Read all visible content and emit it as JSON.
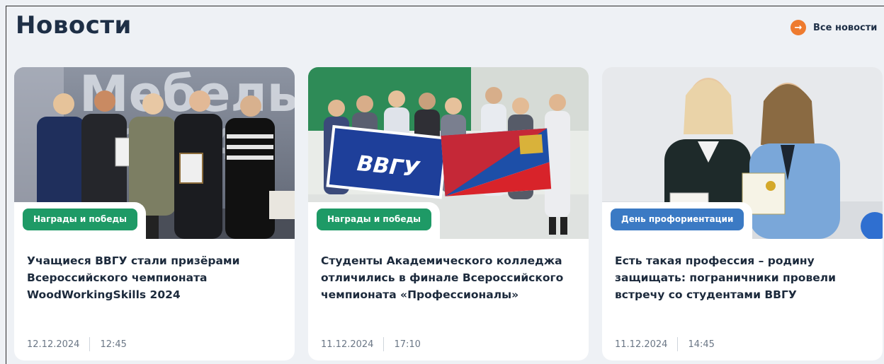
{
  "section": {
    "title": "Новости",
    "all_news_label": "Все новости",
    "all_news_icon": "arrow-right-icon"
  },
  "colors": {
    "accent_orange": "#ee7b2f",
    "tag_green": "#1e9a66",
    "tag_blue": "#3b7ac4",
    "heading": "#1e2f46"
  },
  "news": [
    {
      "tag": "Награды и победы",
      "headline": "Учащиеся ВВГУ стали призёрами Всероссийского чемпионата WoodWorkingSkills 2024",
      "date": "12.12.2024",
      "time": "12:45",
      "photo_text": "Мебель"
    },
    {
      "tag": "Награды и победы",
      "headline": "Студенты Академического колледжа отличились в финале Всероссийского чемпионата «Профессионалы»",
      "date": "11.12.2024",
      "time": "17:10",
      "photo_text": "ВВГУ"
    },
    {
      "tag": "День профориентации",
      "headline": "Есть такая профессия – родину защищать: пограничники провели встречу со студентами ВВГУ",
      "date": "11.12.2024",
      "time": "14:45"
    }
  ]
}
